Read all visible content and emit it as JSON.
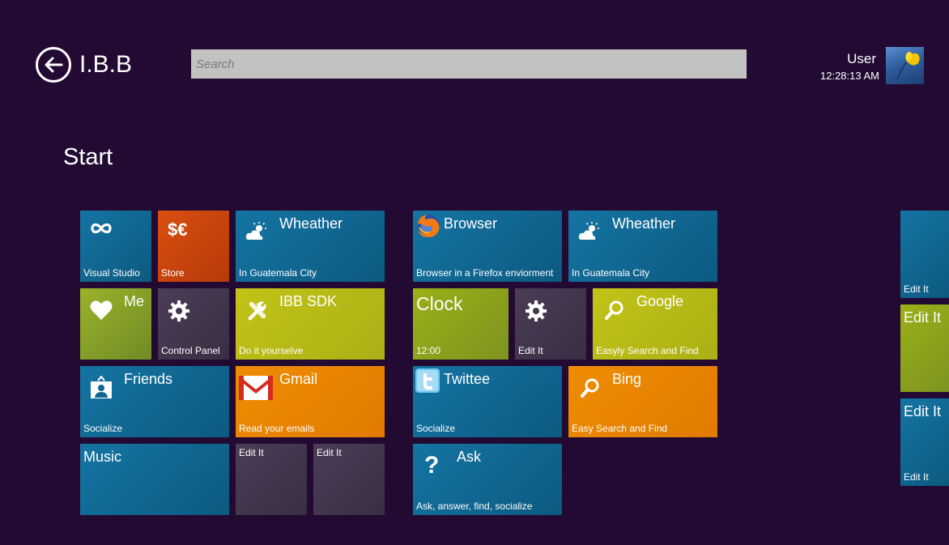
{
  "header": {
    "app_title": "I.B.B",
    "search_placeholder": "Search",
    "user_name": "User",
    "time": "12:28:13 AM"
  },
  "page_heading": "Start",
  "tiles": {
    "visual_studio": {
      "subtitle": "Visual Studio",
      "icon": "infinity-icon"
    },
    "store": {
      "subtitle": "Store",
      "icon": "currency-icon"
    },
    "weather1": {
      "title": "Wheather",
      "subtitle": "In Guatemala City",
      "icon": "weather-icon"
    },
    "me": {
      "title": "Me",
      "icon": "heart-icon"
    },
    "control_panel": {
      "subtitle": "Control Panel",
      "icon": "gear-icon"
    },
    "ibb_sdk": {
      "title": "IBB SDK",
      "subtitle": "Do it yourselve",
      "icon": "tools-icon"
    },
    "friends": {
      "title": "Friends",
      "subtitle": "Socialize",
      "icon": "contact-icon"
    },
    "gmail": {
      "title": "Gmail",
      "subtitle": "Read your emails",
      "icon": "gmail-icon"
    },
    "music": {
      "title": "Music"
    },
    "edit1": {
      "label": "Edit It"
    },
    "edit2": {
      "label": "Edit It"
    },
    "browser": {
      "title": "Browser",
      "subtitle": "Browser in a Firefox enviorment",
      "icon": "firefox-icon"
    },
    "weather2": {
      "title": "Wheather",
      "subtitle": "In Guatemala City",
      "icon": "weather-icon"
    },
    "clock": {
      "title": "Clock",
      "subtitle": "12:00"
    },
    "edit3": {
      "subtitle": "Edit It",
      "icon": "gear-icon"
    },
    "google": {
      "title": "Google",
      "subtitle": "Easyly Search and Find",
      "icon": "magnifier-icon"
    },
    "twittee": {
      "title": "Twittee",
      "subtitle": "Socialize",
      "icon": "twitter-icon"
    },
    "bing": {
      "title": "Bing",
      "subtitle": "Easy Search and Find",
      "icon": "magnifier-icon"
    },
    "ask": {
      "title": "Ask",
      "subtitle": "Ask, answer, find, socialize",
      "icon": "question-icon"
    },
    "right1": {
      "subtitle": "Edit It"
    },
    "right2": {
      "title": "Edit It"
    },
    "right3": {
      "title": "Edit It",
      "subtitle": "Edit It"
    }
  },
  "colors": {
    "background": "#230a33",
    "tile_blue": "#0f6692",
    "tile_orange": "#c9430d",
    "tile_yellow": "#b8bb17",
    "tile_amber": "#e88400",
    "tile_dark": "#42354c",
    "tile_green": "#84a224"
  }
}
